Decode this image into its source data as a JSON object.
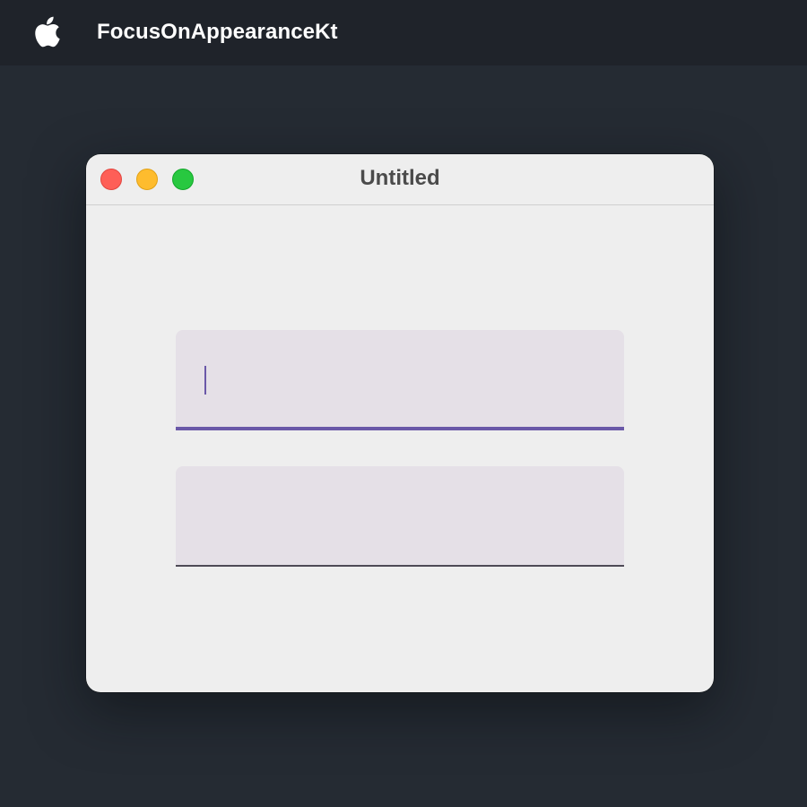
{
  "menubar": {
    "app_name": "FocusOnAppearanceKt",
    "apple_icon": "apple-logo-icon"
  },
  "window": {
    "title": "Untitled",
    "controls": {
      "close_color": "#fe5f57",
      "minimize_color": "#febc2e",
      "zoom_color": "#28c840"
    },
    "fields": [
      {
        "value": "",
        "placeholder": "",
        "focused": true
      },
      {
        "value": "",
        "placeholder": "",
        "focused": false
      }
    ]
  },
  "colors": {
    "desktop": "#252b33",
    "menubar": "#1f232a",
    "window_bg": "#eeeeee",
    "field_bg": "#e5e0e7",
    "focus_accent": "#6a58a8",
    "indicator_unfocused": "#4e4a56"
  }
}
